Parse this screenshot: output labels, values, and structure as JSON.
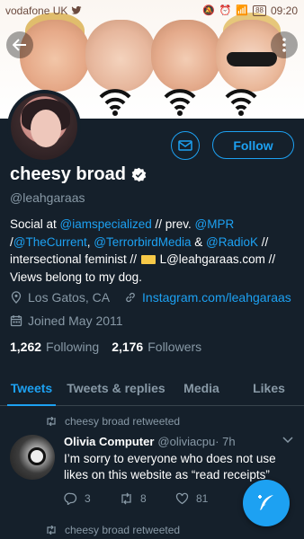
{
  "status_bar": {
    "carrier": "vodafone UK",
    "battery": "88",
    "time": "09:20"
  },
  "profile": {
    "display_name": "cheesy broad",
    "handle": "@leahgaraas",
    "follow_label": "Follow",
    "bio": {
      "t1": "Social at ",
      "l1": "@iamspecialized",
      "t2": " // prev. ",
      "l2": "@MPR",
      "t3": " /",
      "l3": "@TheCurrent",
      "t4": ", ",
      "l4": "@TerrorbirdMedia",
      "t5": " & ",
      "l5": "@RadioK",
      "t6": " // intersectional feminist // ",
      "t7": " L@leahgaraas.com // Views belong to my dog."
    },
    "location": "Los Gatos, CA",
    "website": "Instagram.com/leahgaraas",
    "joined": "Joined May 2011",
    "following_count": "1,262",
    "following_label": "Following",
    "followers_count": "2,176",
    "followers_label": "Followers"
  },
  "tabs": [
    {
      "label": "Tweets"
    },
    {
      "label": "Tweets & replies"
    },
    {
      "label": "Media"
    },
    {
      "label": "Likes"
    }
  ],
  "timeline": {
    "retweet_label": "cheesy broad retweeted",
    "tweet": {
      "author": "Olivia Computer",
      "handle": "@oliviacpu",
      "time": " · 7h",
      "text": "I’m sorry to everyone who does not use likes on this website as “read receipts”",
      "reply_count": "3",
      "retweet_count": "8",
      "like_count": "81"
    }
  },
  "colors": {
    "background": "#15202b",
    "accent": "#1da1f2",
    "secondary_text": "#8899a6"
  }
}
